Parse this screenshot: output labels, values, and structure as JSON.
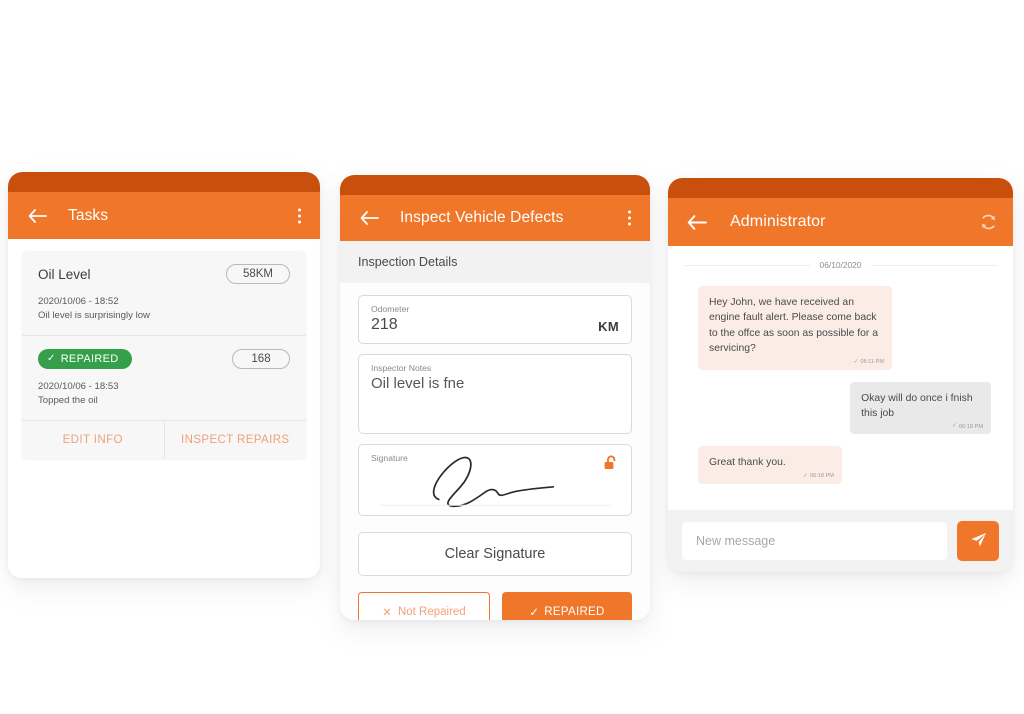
{
  "tasks_screen": {
    "appbar": {
      "back_icon": "arrow-left-icon",
      "title": "Tasks",
      "menu_icon": "overflow-menu-icon"
    },
    "card": {
      "defect_title": "Oil Level",
      "odometer_pill": "58KM",
      "defect_timestamp": "2020/10/06 - 18:52",
      "defect_note": "Oil level is surprisingly low",
      "status_badge": "REPAIRED",
      "status_check_icon": "check-icon",
      "repair_pill": "168",
      "repair_timestamp": "2020/10/06 - 18:53",
      "repair_note": "Topped the oil"
    },
    "actions": {
      "edit": "EDIT INFO",
      "inspect": "INSPECT REPAIRS"
    }
  },
  "inspect_screen": {
    "appbar": {
      "back_icon": "arrow-left-icon",
      "title": "Inspect Vehicle Defects",
      "menu_icon": "overflow-menu-icon"
    },
    "section_title": "Inspection Details",
    "odometer": {
      "label": "Odometer",
      "value": "218",
      "unit": "KM"
    },
    "notes": {
      "label": "Inspector Notes",
      "value": "Oil level is fne"
    },
    "signature": {
      "label": "Signature",
      "lock_icon": "unlock-icon"
    },
    "clear_button": "Clear Signature",
    "not_repaired_button": {
      "label": "Not Repaired",
      "icon": "close-x-icon"
    },
    "repaired_button": {
      "label": "REPAIRED",
      "icon": "check-icon"
    }
  },
  "chat_screen": {
    "appbar": {
      "back_icon": "arrow-left-icon",
      "title": "Administrator",
      "refresh_icon": "refresh-icon"
    },
    "date_separator": "06/10/2020",
    "messages": [
      {
        "direction": "in",
        "text": "Hey John, we have received an engine fault alert. Please come back to the offce as soon as possible for a servicing?",
        "time": "06:11 PM",
        "status_icon": "check-icon"
      },
      {
        "direction": "out",
        "text": "Okay will do once i fnish this job",
        "time": "06:18 PM",
        "status_icon": "check-icon"
      },
      {
        "direction": "in",
        "text": "Great thank you.",
        "time": "06:18 PM",
        "status_icon": "check-icon"
      }
    ],
    "input_placeholder": "New message",
    "send_icon": "send-paper-plane-icon"
  },
  "colors": {
    "accent_orange": "#F0762A",
    "dark_orange": "#C8500C",
    "green": "#35A049",
    "incoming_bubble": "#FBEDE6",
    "outgoing_bubble": "#E9E9E9"
  }
}
